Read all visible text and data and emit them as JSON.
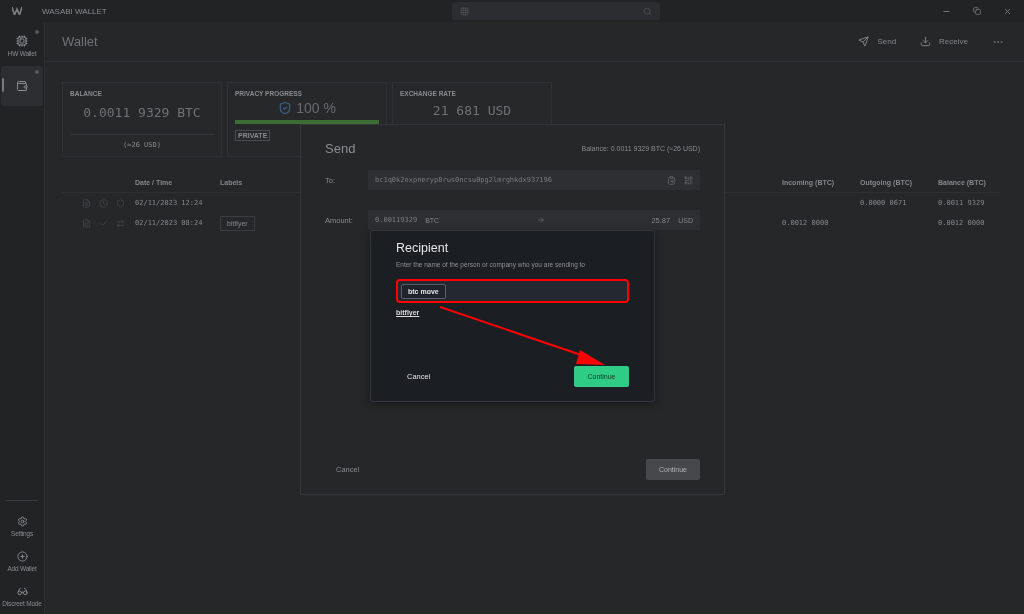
{
  "window": {
    "title": "WASABI WALLET"
  },
  "sidebar": {
    "wallets": [
      {
        "kind": "hardware",
        "label": "HW Wallet",
        "selected": false
      },
      {
        "kind": "software",
        "selected": true
      }
    ],
    "bottom_items": [
      {
        "kind": "settings",
        "label": "Settings"
      },
      {
        "kind": "add",
        "label": "Add Wallet"
      },
      {
        "kind": "discreet",
        "label": "Discreet Mode"
      }
    ]
  },
  "page": {
    "title": "Wallet",
    "actions": [
      {
        "kind": "send",
        "label": "Send"
      },
      {
        "kind": "receive",
        "label": "Receive"
      },
      {
        "kind": "more"
      }
    ]
  },
  "cards": [
    {
      "kind": "balance",
      "title": "BALANCE",
      "value": "0.0011 9329 BTC",
      "sub": "(≈26 USD)"
    },
    {
      "kind": "privacy",
      "title": "PRIVACY PROGRESS",
      "value": "100 %",
      "level": 1,
      "badge": "PRIVATE"
    },
    {
      "kind": "rate",
      "title": "EXCHANGE RATE",
      "value": "21 681 USD"
    }
  ],
  "table": {
    "columns": [
      "Date / Time",
      "Labels",
      "Incoming (BTC)",
      "Outgoing (BTC)",
      "Balance (BTC)"
    ],
    "rows": [
      {
        "confirmed": false,
        "kind": "coinjoin",
        "date": "02/11/2023 12:24",
        "labels": [],
        "outgoing": "0.0000 0671",
        "balance": "0.0011 9329"
      },
      {
        "confirmed": true,
        "kind": "transfer",
        "date": "02/11/2023 08:24",
        "labels": [
          "bitflyer"
        ],
        "incoming": "0.0012 0000",
        "balance": "0.0012 0000"
      }
    ]
  },
  "send_dialog": {
    "title": "Send",
    "balance": "Balance: 0.0011 9329 BTC (≈26 USD)",
    "to_label": "To:",
    "address": "bc1q0k2expneryp8rus0ncsu0pg2lmrghkdx937196",
    "amount_label": "Amount:",
    "amount_btc": "0.00119329",
    "btc_unit": "BTC",
    "usd_amount": "25.87",
    "usd_unit": "USD",
    "cancel": "Cancel",
    "continue": {
      "label": "Continue",
      "disabled": true
    }
  },
  "recipient_dialog": {
    "title": "Recipient",
    "description": "Enter the name of the person or company who you are sending to",
    "highlighted": true,
    "tags": [
      "btc move"
    ],
    "suggestions": [
      "bitflyer"
    ],
    "cancel": "Cancel",
    "continue": {
      "label": "Continue",
      "disabled": false
    }
  },
  "annotation": {
    "kind": "arrow"
  }
}
